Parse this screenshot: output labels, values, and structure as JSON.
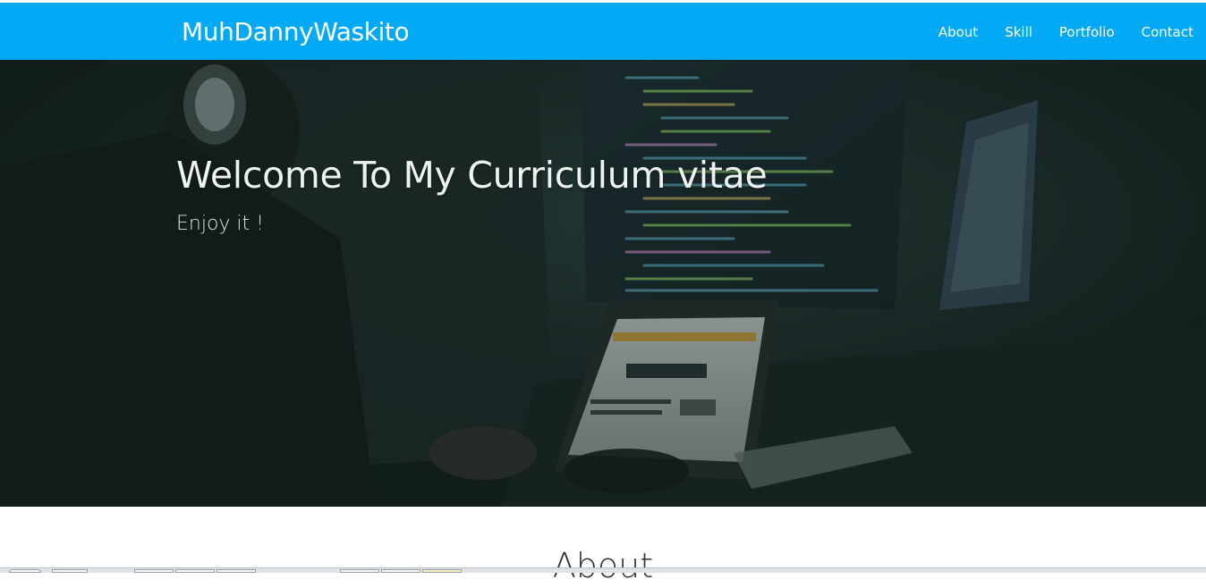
{
  "navbar": {
    "brand": "MuhDannyWaskito",
    "links": [
      "About",
      "Skill",
      "Portfolio",
      "Contact"
    ],
    "background_color": "#03a9f4"
  },
  "hero": {
    "title": "Welcome To My Curriculum vitae",
    "subtitle": "Enjoy it !"
  },
  "about": {
    "heading": "About"
  }
}
